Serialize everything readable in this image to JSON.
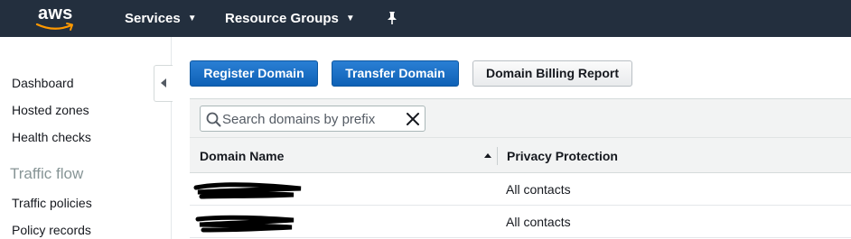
{
  "header": {
    "logo_text": "aws",
    "nav": [
      {
        "label": "Services",
        "icon": "chevron-down-icon"
      },
      {
        "label": "Resource Groups",
        "icon": "chevron-down-icon"
      }
    ],
    "pin_icon": "pin-icon",
    "background": "#232f3e"
  },
  "sidebar": {
    "items": [
      {
        "label": "Dashboard"
      },
      {
        "label": "Hosted zones"
      },
      {
        "label": "Health checks"
      }
    ],
    "section_heading": "Traffic flow",
    "section_items": [
      {
        "label": "Traffic policies"
      },
      {
        "label": "Policy records"
      }
    ],
    "collapse_icon": "caret-left-icon"
  },
  "toolbar": {
    "register_label": "Register Domain",
    "transfer_label": "Transfer Domain",
    "billing_label": "Domain Billing Report",
    "primary_color": "#1166bb"
  },
  "search": {
    "placeholder": "Search domains by prefix",
    "value": "",
    "icon": "search-icon",
    "clear_icon": "close-icon"
  },
  "table": {
    "columns": [
      {
        "label": "Domain Name",
        "sort": "ascending"
      },
      {
        "label": "Privacy Protection"
      }
    ],
    "rows": [
      {
        "domain_name": "[redacted]",
        "privacy_protection": "All contacts"
      },
      {
        "domain_name": "[redacted]",
        "privacy_protection": "All contacts"
      }
    ]
  }
}
